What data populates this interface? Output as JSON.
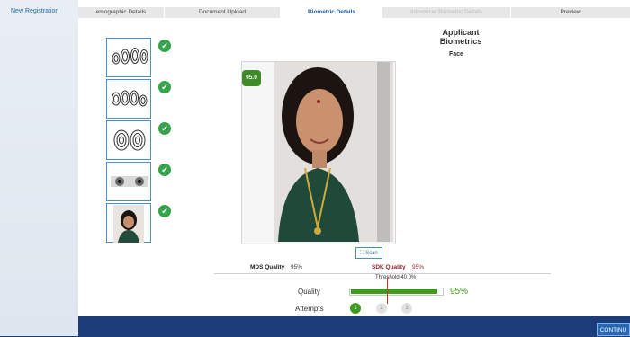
{
  "sidebar": {
    "new_registration": "New Registration"
  },
  "tabs": [
    {
      "label": "emographic Details",
      "state": "normal"
    },
    {
      "label": "Document Upload",
      "state": "normal"
    },
    {
      "label": "Biometric Details",
      "state": "active"
    },
    {
      "label": "Introducer Biometric Details",
      "state": "disabled"
    },
    {
      "label": "Preview",
      "state": "normal"
    }
  ],
  "main": {
    "title": "Applicant Biometrics",
    "face_label": "Face",
    "score_badge": "95.0",
    "scan_label": "Scan",
    "mds_quality_label": "MDS Quality",
    "mds_quality_value": "95%",
    "sdk_quality_label": "SDK Quality",
    "sdk_quality_value": "95%",
    "threshold_text": "Threshold 40.0%",
    "quality_label": "Quality",
    "quality_percent_text": "95%",
    "quality_fraction": 0.95,
    "threshold_fraction": 0.4,
    "attempts_label": "Attempts",
    "attempts": [
      {
        "label": "1",
        "state": "done"
      },
      {
        "label": "2",
        "state": "pending"
      },
      {
        "label": "3",
        "state": "pending"
      }
    ]
  },
  "thumbnails": [
    {
      "name": "left-hand-fingerprints",
      "status": "captured"
    },
    {
      "name": "right-hand-fingerprints",
      "status": "captured"
    },
    {
      "name": "thumb-fingerprints",
      "status": "captured"
    },
    {
      "name": "iris-scan",
      "status": "captured"
    },
    {
      "name": "face-photo",
      "status": "captured"
    }
  ],
  "footer": {
    "continue_label": "CONTINU"
  },
  "colors": {
    "accent": "#2966b3",
    "success": "#3f9a1e",
    "sdk": "#8e1f1f",
    "background": "#1c3d7a"
  }
}
